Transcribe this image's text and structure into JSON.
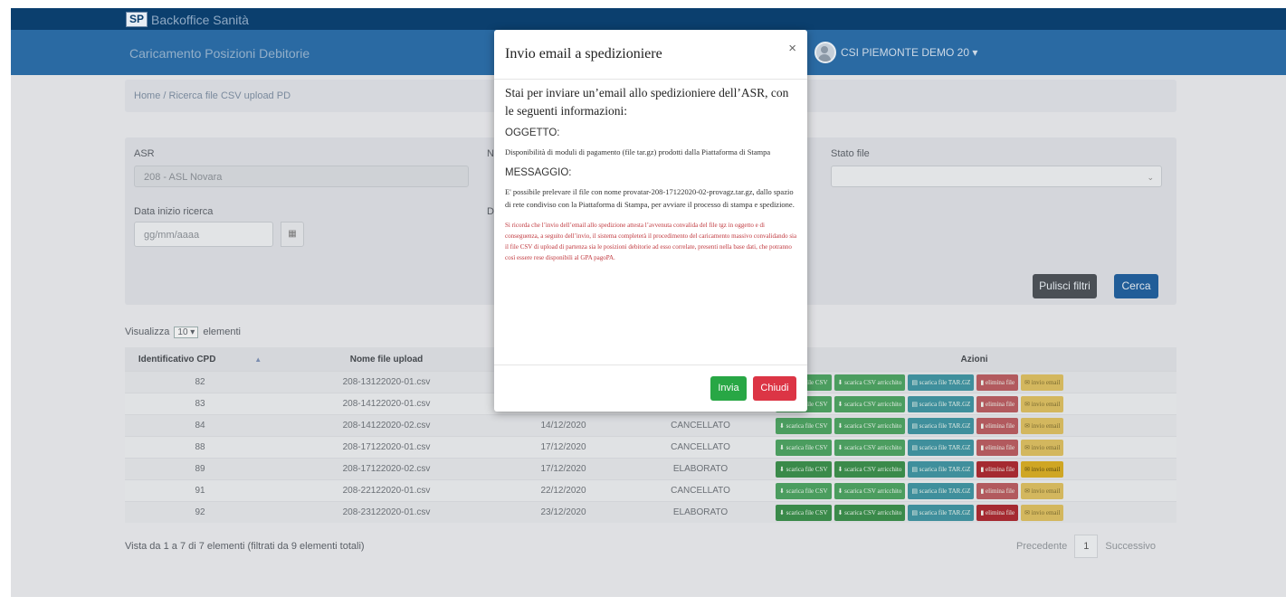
{
  "app": {
    "brand_logo": "SP",
    "brand_name": "Backoffice Sanità",
    "section_title": "Caricamento Posizioni Debitorie",
    "user_name": "CSI PIEMONTE DEMO 20 ▾"
  },
  "breadcrumb": "Home  /  Ricerca file CSV upload PD",
  "filters": {
    "asr_label": "ASR",
    "asr_value": "208 - ASL Novara",
    "second_label": "N",
    "stato_label": "Stato file",
    "data_inizio_label": "Data inizio ricerca",
    "data_inizio_placeholder": "gg/mm/aaaa",
    "data_fine_label": "D",
    "pulisci_button": "Pulisci filtri",
    "cerca_button": "Cerca"
  },
  "table": {
    "show_prefix": "Visualizza",
    "page_size": "10 ▾",
    "show_suffix": "elementi",
    "headers": [
      "Identificativo CPD",
      "Nome file upload",
      "",
      "",
      "Azioni"
    ],
    "sort_icon": "▲",
    "rows": [
      {
        "id": "82",
        "file": "208-13122020-01.csv",
        "date": "",
        "status": ""
      },
      {
        "id": "83",
        "file": "208-14122020-01.csv",
        "date": "",
        "status": ""
      },
      {
        "id": "84",
        "file": "208-14122020-02.csv",
        "date": "14/12/2020",
        "status": "CANCELLATO"
      },
      {
        "id": "88",
        "file": "208-17122020-01.csv",
        "date": "17/12/2020",
        "status": "CANCELLATO"
      },
      {
        "id": "89",
        "file": "208-17122020-02.csv",
        "date": "17/12/2020",
        "status": "ELABORATO"
      },
      {
        "id": "91",
        "file": "208-22122020-01.csv",
        "date": "22/12/2020",
        "status": "CANCELLATO"
      },
      {
        "id": "92",
        "file": "208-23122020-01.csv",
        "date": "23/12/2020",
        "status": "ELABORATO"
      }
    ],
    "actions": {
      "csv": "scarica file CSV",
      "csv_arr": "scarica CSV arricchito",
      "tar": "scarica file TAR.GZ",
      "del": "elimina file",
      "mail": "invio email"
    },
    "info": "Vista da 1 a 7 di 7 elementi (filtrati da 9 elementi totali)",
    "prev": "Precedente",
    "page": "1",
    "next": "Successivo"
  },
  "modal": {
    "title": "Invio email a spedizioniere",
    "close": "×",
    "intro": "Stai per inviare un’email allo spedizioniere dell’ASR, con le seguenti informazioni:",
    "subject_label": "OGGETTO:",
    "subject": "Disponibilità di moduli di pagamento (file tar.gz) prodotti dalla Piattaforma di Stampa",
    "message_label": "MESSAGGIO:",
    "message": "E' possibile prelevare il file con nome provatar-208-17122020-02-provagz.tar.gz, dallo spazio di rete condiviso con la Piattaforma di Stampa, per avviare il processo di stampa e spedizione.",
    "warning": "Si ricorda che l’invio dell’email allo spedizione attesta l’avvenuta convalida del file tgz in oggetto e di conseguenza, a seguito dell’invio, il sistema completerà il procedimento del caricamento massivo convalidando sia il file CSV di upload di partenza sia le posizioni debitorie ad esso correlate, presenti nella base dati, che potranno così essere rese disponibili al GPA pagoPA.",
    "send_button": "Invia",
    "close_button": "Chiudi"
  },
  "colors": {
    "topbar": "#0b3f6e",
    "subbar": "#2a6aa3",
    "send": "#28a745",
    "close": "#dc3545"
  }
}
